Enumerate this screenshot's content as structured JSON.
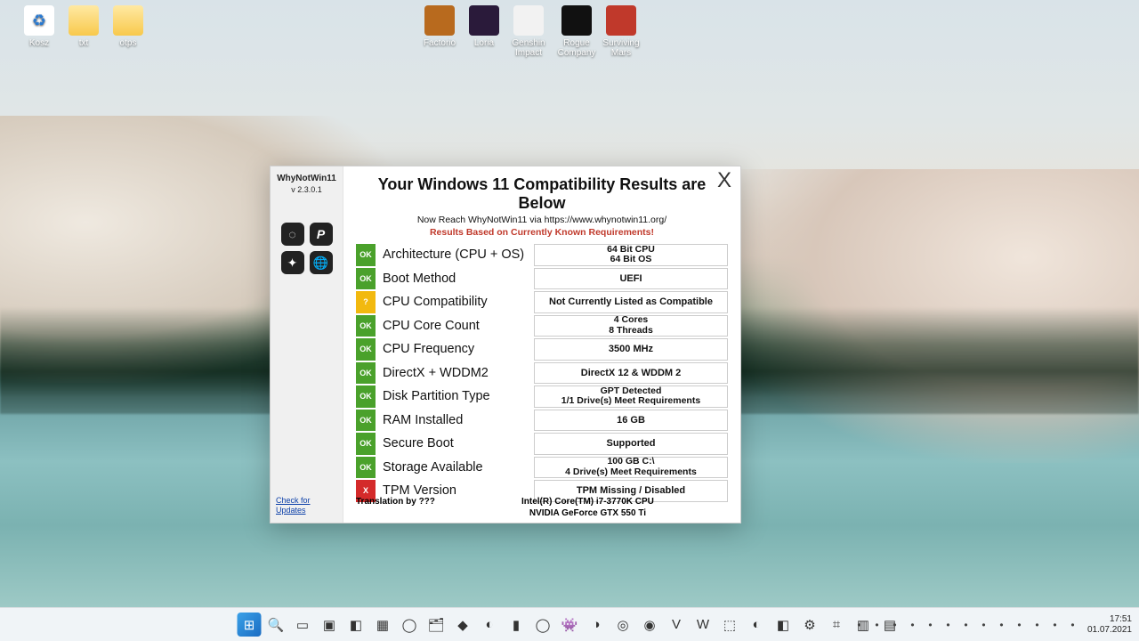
{
  "desktop": {
    "icons": [
      {
        "label": "Kosz",
        "type": "recycle"
      },
      {
        "label": "txt",
        "type": "folder"
      },
      {
        "label": "otps",
        "type": "folder"
      },
      {
        "label": "Factorio",
        "type": "orange"
      },
      {
        "label": "Loria",
        "type": "purple"
      },
      {
        "label": "Genshin Impact",
        "type": "white"
      },
      {
        "label": "Rogue Company",
        "type": "black"
      },
      {
        "label": "Surviving Mars",
        "type": "red"
      }
    ]
  },
  "app": {
    "name": "WhyNotWin11",
    "version": "v 2.3.0.1",
    "links": {
      "update": "Check for Updates"
    },
    "translation": "Translation by ???",
    "title": "Your Windows 11 Compatibility Results are Below",
    "subtitle_prefix": "Now Reach WhyNotWin11 via ",
    "subtitle_url": "https://www.whynotwin11.org/",
    "warning": "Results Based on Currently Known Requirements!",
    "close": "X",
    "side_icons": [
      "github-icon",
      "paypal-icon",
      "discord-icon",
      "globe-icon"
    ],
    "rows": [
      {
        "status": "ok",
        "badge": "OK",
        "label": "Architecture (CPU + OS)",
        "values": [
          "64 Bit CPU",
          "64 Bit OS"
        ]
      },
      {
        "status": "ok",
        "badge": "OK",
        "label": "Boot Method",
        "values": [
          "UEFI"
        ]
      },
      {
        "status": "warn",
        "badge": "?",
        "label": "CPU Compatibility",
        "values": [
          "Not Currently Listed as Compatible"
        ]
      },
      {
        "status": "ok",
        "badge": "OK",
        "label": "CPU Core Count",
        "values": [
          "4 Cores",
          "8 Threads"
        ]
      },
      {
        "status": "ok",
        "badge": "OK",
        "label": "CPU Frequency",
        "values": [
          "3500 MHz"
        ]
      },
      {
        "status": "ok",
        "badge": "OK",
        "label": "DirectX + WDDM2",
        "values": [
          "DirectX 12 & WDDM 2"
        ]
      },
      {
        "status": "ok",
        "badge": "OK",
        "label": "Disk Partition Type",
        "values": [
          "GPT Detected",
          "1/1 Drive(s) Meet Requirements"
        ]
      },
      {
        "status": "ok",
        "badge": "OK",
        "label": "RAM Installed",
        "values": [
          "16 GB"
        ]
      },
      {
        "status": "ok",
        "badge": "OK",
        "label": "Secure Boot",
        "values": [
          "Supported"
        ]
      },
      {
        "status": "ok",
        "badge": "OK",
        "label": "Storage Available",
        "values": [
          "100 GB C:\\",
          "4 Drive(s) Meet Requirements"
        ]
      },
      {
        "status": "bad",
        "badge": "X",
        "label": "TPM Version",
        "values": [
          "TPM Missing / Disabled"
        ]
      }
    ],
    "hw": {
      "cpu": "Intel(R) Core(TM) i7-3770K CPU",
      "gpu": "NVIDIA GeForce GTX 550 Ti"
    }
  },
  "taskbar": {
    "time": "17:51",
    "date": "01.07.2021",
    "tray": [
      "history-icon",
      "circle-icon",
      "steam-icon",
      "cloud-icon",
      "refresh-icon",
      "gamepad-icon",
      "vivaldi-icon",
      "xbox-icon",
      "bluetooth-icon",
      "usb-icon",
      "shield-icon",
      "wifi-icon",
      "volume-icon"
    ]
  }
}
